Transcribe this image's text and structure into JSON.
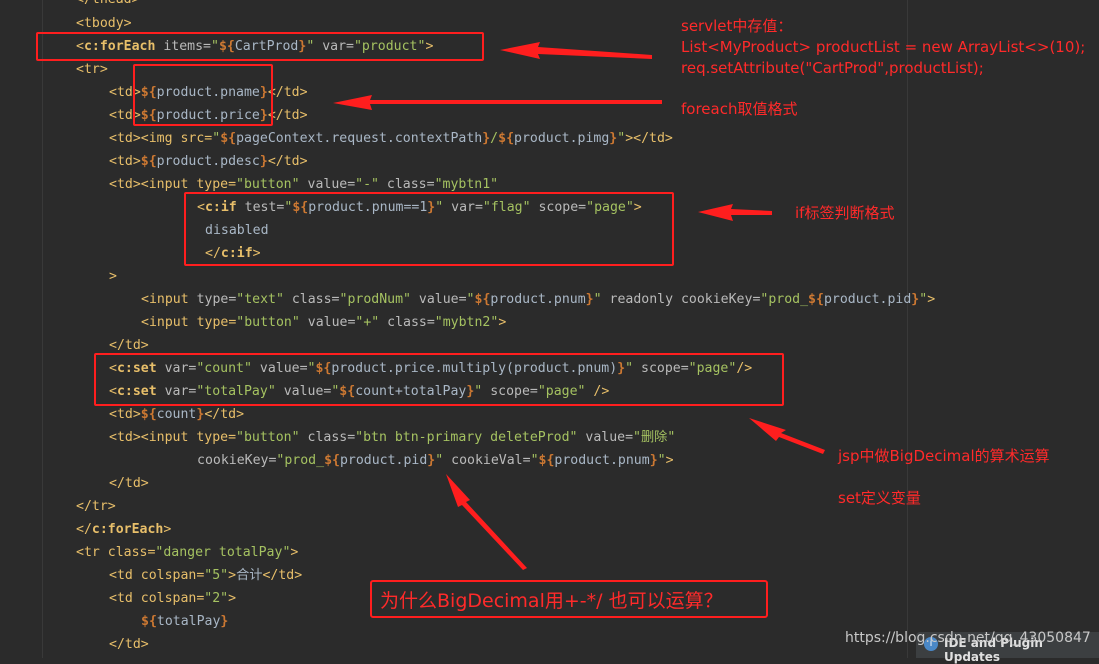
{
  "code_lines": [
    {
      "segments": [
        {
          "t": "</thead>",
          "c": "tag"
        }
      ]
    },
    {
      "segments": [
        {
          "t": "<tbody>",
          "c": "tag"
        }
      ]
    },
    {
      "segments": [
        {
          "t": "<",
          "c": "tag"
        },
        {
          "t": "c:forEach",
          "c": "kw"
        },
        {
          "t": " items=",
          "c": "attr"
        },
        {
          "t": "\"",
          "c": "val"
        },
        {
          "t": "${",
          "c": "el"
        },
        {
          "t": "CartProd",
          "c": "plain"
        },
        {
          "t": "}",
          "c": "el"
        },
        {
          "t": "\"",
          "c": "val"
        },
        {
          "t": " var=",
          "c": "attr"
        },
        {
          "t": "\"product\"",
          "c": "val"
        },
        {
          "t": ">",
          "c": "tag"
        }
      ]
    },
    {
      "segments": [
        {
          "t": "<tr>",
          "c": "tag"
        }
      ]
    },
    {
      "segments": [
        {
          "t": "<td>",
          "c": "tag"
        },
        {
          "t": "${",
          "c": "el"
        },
        {
          "t": "product.pname",
          "c": "plain"
        },
        {
          "t": "}",
          "c": "el"
        },
        {
          "t": "</td>",
          "c": "tag"
        }
      ]
    },
    {
      "segments": [
        {
          "t": "<td>",
          "c": "tag"
        },
        {
          "t": "${",
          "c": "el"
        },
        {
          "t": "product.price",
          "c": "plain"
        },
        {
          "t": "}",
          "c": "el"
        },
        {
          "t": "</td>",
          "c": "tag"
        }
      ]
    },
    {
      "segments": [
        {
          "t": "<td>",
          "c": "tag"
        },
        {
          "t": "<img src=",
          "c": "tag"
        },
        {
          "t": "\"",
          "c": "val"
        },
        {
          "t": "${",
          "c": "el"
        },
        {
          "t": "pageContext.request.contextPath",
          "c": "plain"
        },
        {
          "t": "}",
          "c": "el"
        },
        {
          "t": "/",
          "c": "val"
        },
        {
          "t": "${",
          "c": "el"
        },
        {
          "t": "product.pimg",
          "c": "plain"
        },
        {
          "t": "}",
          "c": "el"
        },
        {
          "t": "\"",
          "c": "val"
        },
        {
          "t": "></td>",
          "c": "tag"
        }
      ]
    },
    {
      "segments": [
        {
          "t": "<td>",
          "c": "tag"
        },
        {
          "t": "${",
          "c": "el"
        },
        {
          "t": "product.pdesc",
          "c": "plain"
        },
        {
          "t": "}",
          "c": "el"
        },
        {
          "t": "</td>",
          "c": "tag"
        }
      ]
    },
    {
      "segments": [
        {
          "t": "<td>",
          "c": "tag"
        },
        {
          "t": "<input type=",
          "c": "tag"
        },
        {
          "t": "\"button\"",
          "c": "val"
        },
        {
          "t": " value=",
          "c": "attr"
        },
        {
          "t": "\"-\"",
          "c": "val"
        },
        {
          "t": " class=",
          "c": "attr"
        },
        {
          "t": "\"mybtn1\"",
          "c": "val"
        }
      ]
    },
    {
      "segments": [
        {
          "t": "<",
          "c": "tag"
        },
        {
          "t": "c:if",
          "c": "kw"
        },
        {
          "t": " test=",
          "c": "attr"
        },
        {
          "t": "\"",
          "c": "val"
        },
        {
          "t": "${",
          "c": "el"
        },
        {
          "t": "product.pnum==1",
          "c": "plain"
        },
        {
          "t": "}",
          "c": "el"
        },
        {
          "t": "\"",
          "c": "val"
        },
        {
          "t": " var=",
          "c": "attr"
        },
        {
          "t": "\"flag\"",
          "c": "val"
        },
        {
          "t": " scope=",
          "c": "attr"
        },
        {
          "t": "\"page\"",
          "c": "val"
        },
        {
          "t": ">",
          "c": "tag"
        }
      ]
    },
    {
      "segments": [
        {
          "t": "disabled",
          "c": "plain"
        }
      ]
    },
    {
      "segments": [
        {
          "t": "</",
          "c": "tag"
        },
        {
          "t": "c:if",
          "c": "kw"
        },
        {
          "t": ">",
          "c": "tag"
        }
      ]
    },
    {
      "segments": [
        {
          "t": ">",
          "c": "tag"
        }
      ]
    },
    {
      "segments": [
        {
          "t": "<input",
          "c": "tag"
        },
        {
          "t": " type=",
          "c": "attr"
        },
        {
          "t": "\"text\"",
          "c": "val"
        },
        {
          "t": " class=",
          "c": "attr"
        },
        {
          "t": "\"prodNum\"",
          "c": "val"
        },
        {
          "t": " value=",
          "c": "attr"
        },
        {
          "t": "\"",
          "c": "val"
        },
        {
          "t": "${",
          "c": "el"
        },
        {
          "t": "product.pnum",
          "c": "plain"
        },
        {
          "t": "}",
          "c": "el"
        },
        {
          "t": "\"",
          "c": "val"
        },
        {
          "t": " readonly ",
          "c": "attr"
        },
        {
          "t": "cookieKey",
          "c": "attr"
        },
        {
          "t": "=",
          "c": "attr"
        },
        {
          "t": "\"prod_",
          "c": "val"
        },
        {
          "t": "${",
          "c": "el"
        },
        {
          "t": "product.pid",
          "c": "plain"
        },
        {
          "t": "}",
          "c": "el"
        },
        {
          "t": "\"",
          "c": "val"
        },
        {
          "t": ">",
          "c": "tag"
        }
      ]
    },
    {
      "segments": [
        {
          "t": "<input type=",
          "c": "tag"
        },
        {
          "t": "\"button\"",
          "c": "val"
        },
        {
          "t": " value=",
          "c": "attr"
        },
        {
          "t": "\"+\"",
          "c": "val"
        },
        {
          "t": " class=",
          "c": "attr"
        },
        {
          "t": "\"mybtn2\"",
          "c": "val"
        },
        {
          "t": ">",
          "c": "tag"
        }
      ]
    },
    {
      "segments": [
        {
          "t": "</td>",
          "c": "tag"
        }
      ]
    },
    {
      "segments": [
        {
          "t": "<",
          "c": "tag"
        },
        {
          "t": "c:set",
          "c": "kw"
        },
        {
          "t": " var=",
          "c": "attr"
        },
        {
          "t": "\"count\"",
          "c": "val"
        },
        {
          "t": " value=",
          "c": "attr"
        },
        {
          "t": "\"",
          "c": "val"
        },
        {
          "t": "${",
          "c": "el"
        },
        {
          "t": "product.price.multiply(product.pnum)",
          "c": "plain"
        },
        {
          "t": "}",
          "c": "el"
        },
        {
          "t": "\"",
          "c": "val"
        },
        {
          "t": " scope=",
          "c": "attr"
        },
        {
          "t": "\"page\"",
          "c": "val"
        },
        {
          "t": "/>",
          "c": "tag"
        }
      ]
    },
    {
      "segments": [
        {
          "t": "<",
          "c": "tag"
        },
        {
          "t": "c:set",
          "c": "kw"
        },
        {
          "t": " var=",
          "c": "attr"
        },
        {
          "t": "\"totalPay\"",
          "c": "val"
        },
        {
          "t": " value=",
          "c": "attr"
        },
        {
          "t": "\"",
          "c": "val"
        },
        {
          "t": "${",
          "c": "el"
        },
        {
          "t": "count+totalPay",
          "c": "plain"
        },
        {
          "t": "}",
          "c": "el"
        },
        {
          "t": "\"",
          "c": "val"
        },
        {
          "t": " scope=",
          "c": "attr"
        },
        {
          "t": "\"page\"",
          "c": "val"
        },
        {
          "t": " />",
          "c": "tag"
        }
      ]
    },
    {
      "segments": [
        {
          "t": "<td>",
          "c": "tag"
        },
        {
          "t": "${",
          "c": "el"
        },
        {
          "t": "count",
          "c": "plain"
        },
        {
          "t": "}",
          "c": "el"
        },
        {
          "t": "</td>",
          "c": "tag"
        }
      ]
    },
    {
      "segments": [
        {
          "t": "<td>",
          "c": "tag"
        },
        {
          "t": "<input type=",
          "c": "tag"
        },
        {
          "t": "\"button\"",
          "c": "val"
        },
        {
          "t": " class=",
          "c": "attr"
        },
        {
          "t": "\"btn btn-primary deleteProd\"",
          "c": "val"
        },
        {
          "t": " value=",
          "c": "attr"
        },
        {
          "t": "\"删除\"",
          "c": "val"
        }
      ]
    },
    {
      "segments": [
        {
          "t": "cookieKey",
          "c": "attr"
        },
        {
          "t": "=",
          "c": "attr"
        },
        {
          "t": "\"prod_",
          "c": "val"
        },
        {
          "t": "${",
          "c": "el"
        },
        {
          "t": "product.pid",
          "c": "plain"
        },
        {
          "t": "}",
          "c": "el"
        },
        {
          "t": "\"",
          "c": "val"
        },
        {
          "t": " cookieVal",
          "c": "attr"
        },
        {
          "t": "=",
          "c": "attr"
        },
        {
          "t": "\"",
          "c": "val"
        },
        {
          "t": "${",
          "c": "el"
        },
        {
          "t": "product.pnum",
          "c": "plain"
        },
        {
          "t": "}",
          "c": "el"
        },
        {
          "t": "\"",
          "c": "val"
        },
        {
          "t": ">",
          "c": "tag"
        }
      ]
    },
    {
      "segments": [
        {
          "t": "</td>",
          "c": "tag"
        }
      ]
    },
    {
      "segments": [
        {
          "t": "</tr>",
          "c": "tag"
        }
      ]
    },
    {
      "segments": [
        {
          "t": "</",
          "c": "tag"
        },
        {
          "t": "c:forEach",
          "c": "kw"
        },
        {
          "t": ">",
          "c": "tag"
        }
      ]
    },
    {
      "segments": [
        {
          "t": "<tr class=",
          "c": "tag"
        },
        {
          "t": "\"danger totalPay\"",
          "c": "val"
        },
        {
          "t": ">",
          "c": "tag"
        }
      ]
    },
    {
      "segments": [
        {
          "t": "<td colspan=",
          "c": "tag"
        },
        {
          "t": "\"5\"",
          "c": "val"
        },
        {
          "t": ">",
          "c": "tag"
        },
        {
          "t": "合计",
          "c": "plain"
        },
        {
          "t": "</td>",
          "c": "tag"
        }
      ]
    },
    {
      "segments": [
        {
          "t": "<td colspan=",
          "c": "tag"
        },
        {
          "t": "\"2\"",
          "c": "val"
        },
        {
          "t": ">",
          "c": "tag"
        }
      ]
    },
    {
      "segments": [
        {
          "t": "${",
          "c": "el"
        },
        {
          "t": "totalPay",
          "c": "plain"
        },
        {
          "t": "}",
          "c": "el"
        }
      ]
    },
    {
      "segments": [
        {
          "t": "</td>",
          "c": "tag"
        }
      ]
    }
  ],
  "annotations": {
    "servlet_note": "servlet中存值：\nList<MyProduct> productList = new ArrayList<>(10);\nreq.setAttribute(\"CartProd\",productList);",
    "foreach_note": "foreach取值格式",
    "if_note": "if标签判断格式",
    "bigdecimal_note": "jsp中做BigDecimal的算术运算",
    "set_note": "set定义变量",
    "question": "为什么BigDecimal用+-*/ 也可以运算？"
  },
  "watermark": "https://blog.csdn.net/qq_43050847",
  "ide_updates": "IDE and Plugin Updates",
  "colors": {
    "annotation": "#ff2a2a",
    "background": "#2b2b2b",
    "tag": "#e8bf6a",
    "value": "#a5c261"
  }
}
